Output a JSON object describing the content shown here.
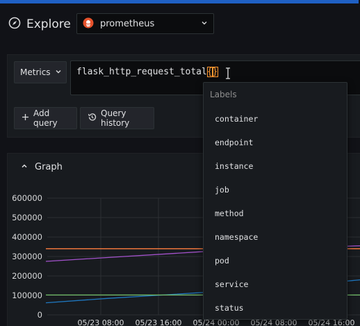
{
  "header": {
    "title": "Explore",
    "datasource": "prometheus"
  },
  "query": {
    "metrics_label": "Metrics",
    "expression": "flask_http_request_total",
    "brace_open": "{",
    "brace_close": "}",
    "add_query_label": "Add query",
    "query_history_label": "Query history"
  },
  "dropdown": {
    "header": "Labels",
    "items": [
      "container",
      "endpoint",
      "instance",
      "job",
      "method",
      "namespace",
      "pod",
      "service",
      "status"
    ]
  },
  "graph": {
    "title": "Graph"
  },
  "chart_data": {
    "type": "line",
    "y_ticks": [
      "600000",
      "500000",
      "400000",
      "300000",
      "200000",
      "100000",
      "0"
    ],
    "x_ticks": [
      "05/23 08:00",
      "05/23 16:00",
      "05/24 00:00",
      "05/24 08:00",
      "05/24 16:00"
    ],
    "ylim": [
      0,
      600000
    ],
    "series": [
      {
        "color": "#ff7e3f",
        "x": [
          0,
          1,
          2,
          3,
          4,
          5
        ],
        "values": [
          340000,
          340000,
          340000,
          340000,
          340000,
          340000
        ]
      },
      {
        "color": "#a352cc",
        "x": [
          0,
          1,
          2,
          3,
          4,
          5
        ],
        "values": [
          275000,
          295000,
          315000,
          335000,
          345000,
          355000
        ]
      },
      {
        "color": "#1f78c1",
        "x": [
          0,
          1,
          2,
          3,
          4,
          5
        ],
        "values": [
          62000,
          85000,
          105000,
          125000,
          150000,
          180000
        ]
      },
      {
        "color": "#73bf69",
        "x": [
          0,
          1,
          2,
          3,
          4,
          5
        ],
        "values": [
          102000,
          102000,
          102000,
          102000,
          102000,
          102000
        ]
      }
    ],
    "grid": true
  }
}
